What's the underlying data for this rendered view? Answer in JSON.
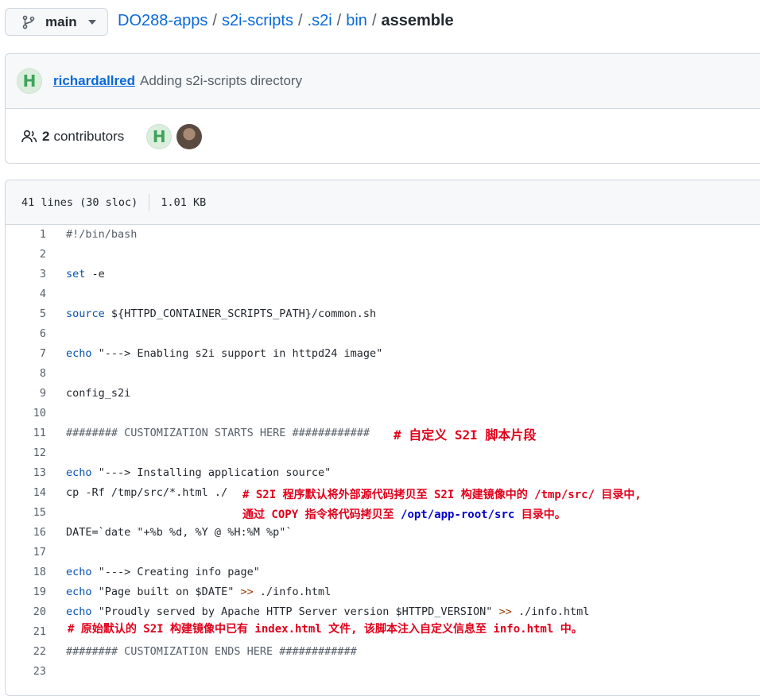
{
  "branch": {
    "name": "main"
  },
  "breadcrumb": {
    "repo": "DO288-apps",
    "parts": [
      "s2i-scripts",
      ".s2i",
      "bin"
    ],
    "current": "assemble"
  },
  "commit": {
    "author": "richardallred",
    "message": "Adding s2i-scripts directory"
  },
  "contributors": {
    "count": "2",
    "label": "contributors"
  },
  "file_info": {
    "lines": "41 lines (30 sloc)",
    "size": "1.01 KB"
  },
  "code": {
    "l1": "#!/bin/bash",
    "l3_kw": "set",
    "l3_rest": " -e",
    "l5_kw": "source",
    "l5_rest": " ${HTTPD_CONTAINER_SCRIPTS_PATH}/common.sh",
    "l7_kw": "echo",
    "l7_rest": " \"---> Enabling s2i support in httpd24 image\"",
    "l9": "config_s2i",
    "l11": "######## CUSTOMIZATION STARTS HERE ############",
    "l13_kw": "echo",
    "l13_rest": " \"---> Installing application source\"",
    "l14": "cp -Rf /tmp/src/*.html ./",
    "l16": "DATE=`date \"+%b %d, %Y @ %H:%M %p\"`",
    "l18_kw": "echo",
    "l18_rest": " \"---> Creating info page\"",
    "l19_kw": "echo",
    "l19_str": " \"Page built on $DATE\" ",
    "l19_gt": ">>",
    "l19_rest": " ./info.html",
    "l20_kw": "echo",
    "l20_str": " \"Proudly served by Apache HTTP Server version $HTTPD_VERSION\" ",
    "l20_gt": ">>",
    "l20_rest": " ./info.html",
    "l22": "######## CUSTOMIZATION ENDS HERE ############"
  },
  "line_numbers": [
    "1",
    "2",
    "3",
    "4",
    "5",
    "6",
    "7",
    "8",
    "9",
    "10",
    "11",
    "12",
    "13",
    "14",
    "15",
    "16",
    "17",
    "18",
    "19",
    "20",
    "21",
    "22",
    "23"
  ],
  "annotations": {
    "a11": "# 自定义 S2I 脚本片段",
    "a14": "# S2I 程序默认将外部源代码拷贝至 S2I 构建镜像中的 /tmp/src/ 目录中,",
    "a15_pre": "通过 COPY 指令将代码拷贝至 ",
    "a15_path": "/opt/app-root/src",
    "a15_post": " 目录中。",
    "a21": "# 原始默认的 S2I 构建镜像中已有 index.html 文件, 该脚本注入自定义信息至 info.html 中。"
  },
  "colors": {
    "link": "#0969da",
    "annotation": "#e0001b",
    "annotation_path": "#0000cc"
  },
  "icons": [
    "git-branch-icon",
    "caret-down-icon",
    "people-icon",
    "avatar-icon"
  ]
}
